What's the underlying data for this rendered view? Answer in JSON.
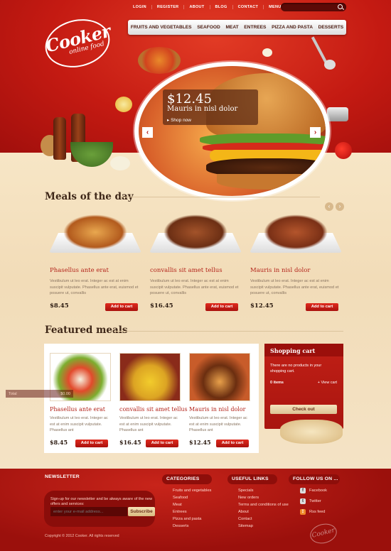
{
  "topnav": [
    "LOGIN",
    "REGISTER",
    "ABOUT",
    "BLOG",
    "CONTACT",
    "MENU CARD"
  ],
  "search": {
    "placeholder": ""
  },
  "logo": {
    "main": "Cooker",
    "sub": "online food"
  },
  "catnav": [
    "FRUITS AND VEGETABLES",
    "SEAFOOD",
    "MEAT",
    "ENTREES",
    "PIZZA AND PASTA",
    "DESSERTS"
  ],
  "hero": {
    "price": "$12.45",
    "name": "Mauris in nisl dolor",
    "link": "Shop now",
    "prev": "‹",
    "next": "›"
  },
  "meals_title": "Meals of the day",
  "meals_nav": {
    "prev": "‹",
    "next": "›"
  },
  "meals": [
    {
      "name": "Phasellus ante erat",
      "desc": "Vestibulum ut leo erat. Integer ac est at enim suscipit vulputate. Phasellus ante erat, euismod et posuere ut, convallis",
      "price": "$8.45",
      "button": "Add to cart"
    },
    {
      "name": "convallis sit amet tellus",
      "desc": "Vestibulum ut leo erat. Integer ac est at enim suscipit vulputate. Phasellus ante erat, euismod et posuere ut, convallis",
      "price": "$16.45",
      "button": "Add to cart"
    },
    {
      "name": "Mauris in nisl dolor",
      "desc": "Vestibulum ut leo erat. Integer ac est at enim suscipit vulputate. Phasellus ante erat, euismod et posuere ut, convallis",
      "price": "$12.45",
      "button": "Add to cart"
    }
  ],
  "featured_title": "Featured meals",
  "featured": [
    {
      "name": "Phasellus ante erat",
      "desc": "Vestibulum ut leo erat. Integer ac est at enim suscipit vulputate. Phasellus ant",
      "price": "$8.45",
      "button": "Add to cart"
    },
    {
      "name": "convallis sit amet tellus",
      "desc": "Vestibulum ut leo erat. Integer ac est at enim suscipit vulputate. Phasellus ant",
      "price": "$16.45",
      "button": "Add to cart"
    },
    {
      "name": "Mauris in nisl dolor",
      "desc": "Vestibulum ut leo erat. Integer ac est at enim suscipit vulputate. Phasellus ant",
      "price": "$12.45",
      "button": "Add to cart"
    }
  ],
  "cart": {
    "title": "Shopping cart",
    "empty": "There are no products in your shopping cart.",
    "items": "0 items",
    "view": "+ View cart",
    "total_label": "Total",
    "total_value": "$0.00",
    "checkout": "Check out"
  },
  "footer": {
    "newsletter": {
      "title": "NEWSLETTER",
      "text": "Sign-up for our newsletter and be always aware of the new offers and services:",
      "placeholder": "enter your e-mail address...",
      "button": "Subscribe"
    },
    "categories": {
      "title": "CATEGORIES",
      "items": [
        "Fruits and vegetables",
        "Seafood",
        "Meat",
        "Entrees",
        "Pizza and pasta",
        "Desserts"
      ]
    },
    "useful": {
      "title": "USEFUL LINKS",
      "items": [
        "Specials",
        "New orders",
        "Terms and conditions of use",
        "About",
        "Contact",
        "Sitemap"
      ]
    },
    "follow": {
      "title": "FOLLOW US ON ...",
      "items": [
        {
          "label": "Facebook",
          "icon": "facebook-icon"
        },
        {
          "label": "Twitter",
          "icon": "twitter-icon"
        },
        {
          "label": "Rss feed",
          "icon": "rss-icon"
        }
      ]
    },
    "copyright": "Copyright © 2012 Cooker. All rights reserved",
    "logo": "Cooker"
  },
  "colors": {
    "primary_red": "#c41a12",
    "dark_red": "#9b100c",
    "cream": "#f4e3c5",
    "accent_text": "#b3231a"
  }
}
